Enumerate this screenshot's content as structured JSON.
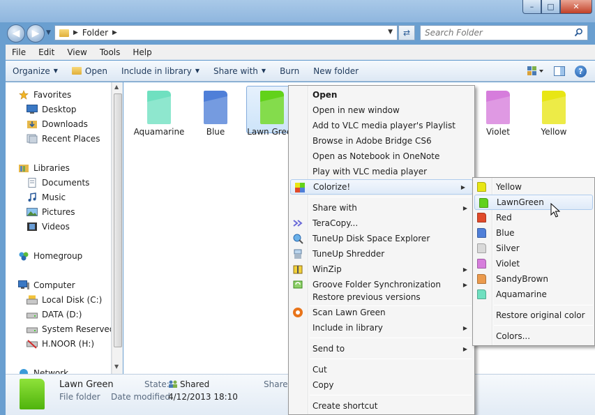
{
  "window": {
    "address_path": "Folder",
    "search_placeholder": "Search Folder"
  },
  "menubar": [
    "File",
    "Edit",
    "View",
    "Tools",
    "Help"
  ],
  "toolbar": {
    "organize": "Organize",
    "open": "Open",
    "include_in_library": "Include in library",
    "share_with": "Share with",
    "burn": "Burn",
    "new_folder": "New folder"
  },
  "navpane": {
    "favorites": "Favorites",
    "desktop": "Desktop",
    "downloads": "Downloads",
    "recent_places": "Recent Places",
    "libraries": "Libraries",
    "documents": "Documents",
    "music": "Music",
    "pictures": "Pictures",
    "videos": "Videos",
    "homegroup": "Homegroup",
    "computer": "Computer",
    "local_disk": "Local Disk (C:)",
    "data_disk": "DATA (D:)",
    "system_reserved": "System Reserved (",
    "hnoor": "H.NOOR (H:)",
    "network": "Network"
  },
  "folders": [
    {
      "label": "Aquamarine",
      "color": "#6fe0c0"
    },
    {
      "label": "Blue",
      "color": "#4f7fd8"
    },
    {
      "label": "Lawn Green",
      "color": "#62d21a"
    },
    {
      "label": "Violet",
      "color": "#d67ddc"
    },
    {
      "label": "Yellow",
      "color": "#e8e614"
    }
  ],
  "context_menu": {
    "open": "Open",
    "open_new_window": "Open in new window",
    "vlc_playlist": "Add to VLC media player's Playlist",
    "bridge": "Browse in Adobe Bridge CS6",
    "onenote": "Open as Notebook in OneNote",
    "vlc_play": "Play with VLC media player",
    "colorize": "Colorize!",
    "share_with": "Share with",
    "teracopy": "TeraCopy...",
    "tuneup_explorer": "TuneUp Disk Space Explorer",
    "tuneup_shredder": "TuneUp Shredder",
    "winzip": "WinZip",
    "groove": "Groove Folder Synchronization",
    "restore_versions": "Restore previous versions",
    "scan": "Scan Lawn Green",
    "include_library": "Include in library",
    "send_to": "Send to",
    "cut": "Cut",
    "copy": "Copy",
    "create_shortcut": "Create shortcut"
  },
  "colorize_submenu": {
    "items": [
      {
        "label": "Yellow",
        "color": "#e8e614"
      },
      {
        "label": "LawnGreen",
        "color": "#62d21a"
      },
      {
        "label": "Red",
        "color": "#e04a2a"
      },
      {
        "label": "Blue",
        "color": "#4f7fd8"
      },
      {
        "label": "Silver",
        "color": "#d9d9d9"
      },
      {
        "label": "Violet",
        "color": "#d67ddc"
      },
      {
        "label": "SandyBrown",
        "color": "#eb9a4d"
      },
      {
        "label": "Aquamarine",
        "color": "#6fe0c0"
      }
    ],
    "restore": "Restore original color",
    "colors": "Colors..."
  },
  "details": {
    "name": "Lawn Green",
    "type": "File folder",
    "state_label": "State:",
    "state_value": "Shared",
    "date_label": "Date modified:",
    "date_value": "4/12/2013 18:10",
    "shared_cut": "Shared"
  }
}
